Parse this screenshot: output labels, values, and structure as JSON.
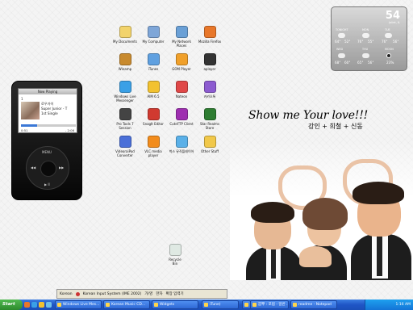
{
  "desktop_icons": [
    {
      "label": "My Documents",
      "color": "#f2d36b"
    },
    {
      "label": "My Computer",
      "color": "#7ea6d8"
    },
    {
      "label": "My Network Places",
      "color": "#6aa0d6"
    },
    {
      "label": "Mozilla Firefox",
      "color": "#e8772a"
    },
    {
      "label": "Winamp",
      "color": "#c88a2e"
    },
    {
      "label": "iTunes",
      "color": "#5fa0e0"
    },
    {
      "label": "GOM Player",
      "color": "#f0a02a"
    },
    {
      "label": "aplayer",
      "color": "#333333"
    },
    {
      "label": "Windows Live Messenger",
      "color": "#3aa0e6"
    },
    {
      "label": "AIM 6.5",
      "color": "#f2c230"
    },
    {
      "label": "Nateon",
      "color": "#e04848"
    },
    {
      "label": "카카오톡",
      "color": "#8c5bd0"
    },
    {
      "label": "Pro Tools 7 Session",
      "color": "#444444"
    },
    {
      "label": "SnagIt Editor",
      "color": "#d03a30"
    },
    {
      "label": "CuteFTP Client",
      "color": "#9e2eb0"
    },
    {
      "label": "Star Realms Store",
      "color": "#2e7d32"
    },
    {
      "label": "VideoraiPod Converter",
      "color": "#4a6fd8"
    },
    {
      "label": "VLC media player",
      "color": "#f28c1c"
    },
    {
      "label": "벅스 뮤직플레이어",
      "color": "#5ab0e8"
    },
    {
      "label": "Other Stuff",
      "color": "#f1c84a"
    }
  ],
  "ipod": {
    "header": "Now Playing",
    "counter": "1",
    "song": "로우가이",
    "artist": "Super Junior - T",
    "album": "1st Single",
    "elapsed": "0:51",
    "remaining": "- 2:06",
    "progress": 0.29,
    "menu_label": "MENU",
    "play_label": "▶ II"
  },
  "weather": {
    "temp": "54",
    "city": "Joliet, IL",
    "days": [
      "TONIGHT",
      "MON",
      "TUE",
      "WED",
      "THU",
      "MOON"
    ],
    "temps": [
      "64°",
      "52°",
      "76°",
      "55°",
      "76°",
      "56°",
      "68°",
      "60°",
      "65°",
      "56°",
      "23%"
    ]
  },
  "slogan": {
    "title": "Show me Your love!!!",
    "names": "강인 + 희철 + 신동"
  },
  "recycle_bin": {
    "label": "Recycle Bin"
  },
  "langbar": {
    "lang": "Korean",
    "ime": "Korean Input System (IME 2002)",
    "han": "가/영",
    "hanja": "한자",
    "mode": "확장 입력기"
  },
  "taskbar": {
    "start_label": "Start",
    "tasks": [
      "Windows Live Mes...",
      "Korean Music CD...",
      "Widgets",
      "iTune)",
      "...",
      "뽐뿌 : 포럼 - 일반 ...",
      "readme - Notepad"
    ],
    "clock": "1:16 AM"
  }
}
